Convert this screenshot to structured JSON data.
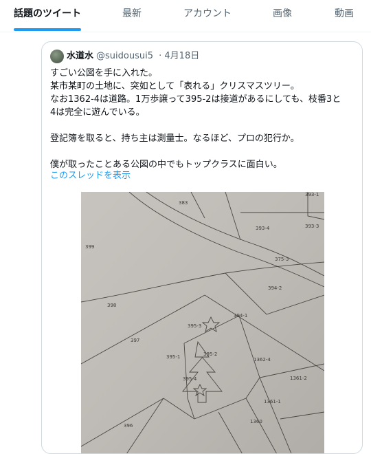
{
  "tabs": [
    {
      "label": "話題のツイート",
      "active": true
    },
    {
      "label": "最新",
      "active": false
    },
    {
      "label": "アカウント",
      "active": false
    },
    {
      "label": "画像",
      "active": false
    },
    {
      "label": "動画",
      "active": false
    }
  ],
  "tweet": {
    "display_name": "水道水",
    "handle": "@suidousui5",
    "separator": "·",
    "date": "4月18日",
    "lines": [
      "すごい公図を手に入れた。",
      "某市某町の土地に、突如として「表れる」クリスマスツリー。",
      "なお1362-4は道路。1万歩譲って395-2は接道があるにしても、枝番3と",
      "4は完全に遊んでいる。",
      "",
      "登記簿を取ると、持ち主は測量士。なるほど、プロの犯行か。",
      "",
      "僕が取ったことある公図の中でもトップクラスに面白い。"
    ],
    "show_thread": "このスレッドを表示"
  },
  "map_labels": {
    "l383": "383",
    "l393_1": "393-1",
    "l393_4": "393-4",
    "l393_3": "393-3",
    "l399": "399",
    "l375_3": "375-3",
    "l394_2": "394-2",
    "l398": "398",
    "l394_1": "394-1",
    "l395_3": "395-3",
    "l397": "397",
    "l395_1": "395-1",
    "l395_2": "395-2",
    "l1362_4": "1362-4",
    "l395_4": "395-4",
    "l1361_2": "1361-2",
    "l1361_1": "1361-1",
    "l396": "396",
    "l1360": "1360"
  },
  "colors": {
    "accent": "#1d9bf0",
    "text": "#0f1419",
    "muted": "#536471",
    "border": "#cfd9de"
  }
}
